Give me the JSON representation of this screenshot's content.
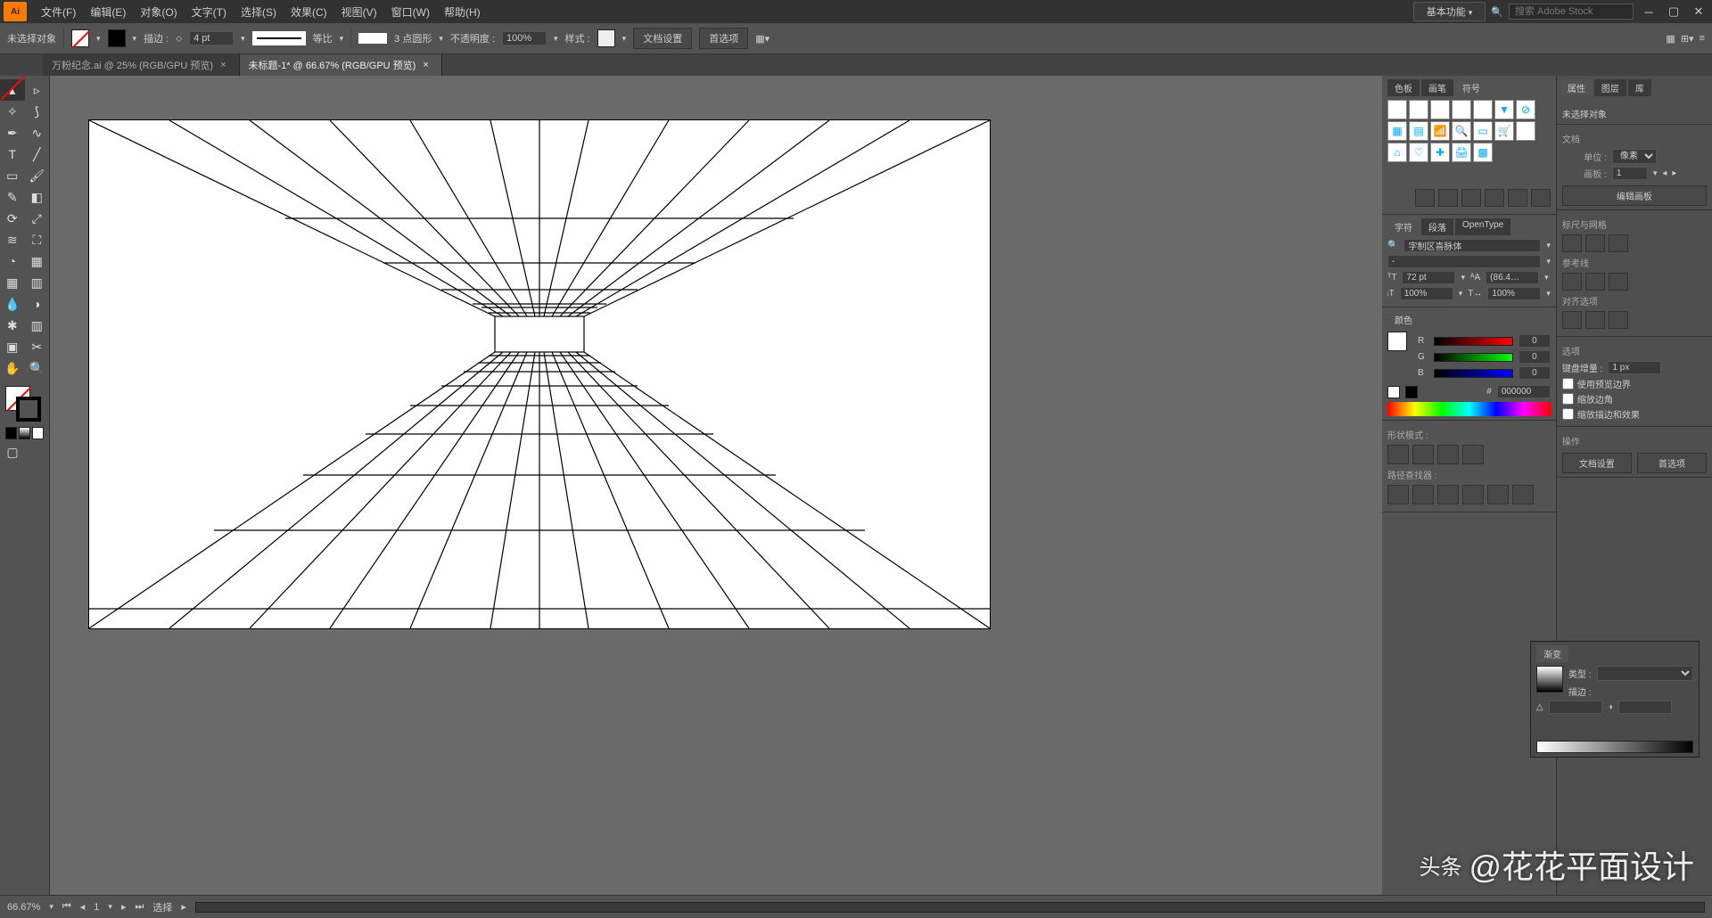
{
  "menubar": {
    "items": [
      "文件(F)",
      "编辑(E)",
      "对象(O)",
      "文字(T)",
      "选择(S)",
      "效果(C)",
      "视图(V)",
      "窗口(W)",
      "帮助(H)"
    ],
    "workspace": "基本功能",
    "search_placeholder": "搜索 Adobe Stock"
  },
  "controlbar": {
    "selection": "未选择对象",
    "stroke_label": "描边 :",
    "stroke_weight": "4 pt",
    "stroke_profile": "等比",
    "brush_label": "3 点圆形",
    "opacity_label": "不透明度 :",
    "opacity_value": "100%",
    "style_label": "样式 :",
    "doc_setup": "文档设置",
    "prefs": "首选项"
  },
  "tabs": [
    {
      "label": "万粉纪念.ai @ 25% (RGB/GPU 预览)",
      "active": false
    },
    {
      "label": "未标题-1* @ 66.67% (RGB/GPU 预览)",
      "active": true
    }
  ],
  "panels": {
    "swatches_tabs": [
      "色板",
      "画笔",
      "符号"
    ],
    "char_tabs": [
      "字符",
      "段落",
      "OpenType"
    ],
    "font_name": "字制区喜脉体",
    "font_size": "72 pt",
    "leading": "(86.4…",
    "tracking": "100%",
    "h_scale": "100%",
    "color_tab": "颜色",
    "rgb": {
      "r": "0",
      "g": "0",
      "b": "0",
      "hex": "000000"
    },
    "shape_modes": "形状模式 :",
    "pathfinder": "路径查找器 :",
    "gradient": {
      "title": "渐变",
      "type_label": "类型 :",
      "stroke_label": "描边 :"
    },
    "properties": {
      "tabs": [
        "属性",
        "图层",
        "库"
      ],
      "no_selection": "未选择对象",
      "transform": "文档",
      "units_label": "单位 :",
      "units_value": "像素",
      "artboard_label": "画板 :",
      "artboard_value": "1",
      "edit_artboards": "编辑画板",
      "ruler_grid": "标尺与网格",
      "guides": "参考线",
      "snap": "对齐选项",
      "quick_actions": "选项",
      "key_increment_label": "键盘增量 :",
      "key_increment": "1 px",
      "use_preview": "使用预览边界",
      "scale_corners": "缩放边角",
      "scale_strokes": "缩放描边和效果",
      "quick": "操作",
      "doc_setup": "文档设置",
      "prefs": "首选项"
    }
  },
  "statusbar": {
    "zoom": "66.67%",
    "artboard": "1",
    "tool": "选择"
  },
  "watermark": {
    "prefix": "头条",
    "handle": "@花花平面设计"
  }
}
